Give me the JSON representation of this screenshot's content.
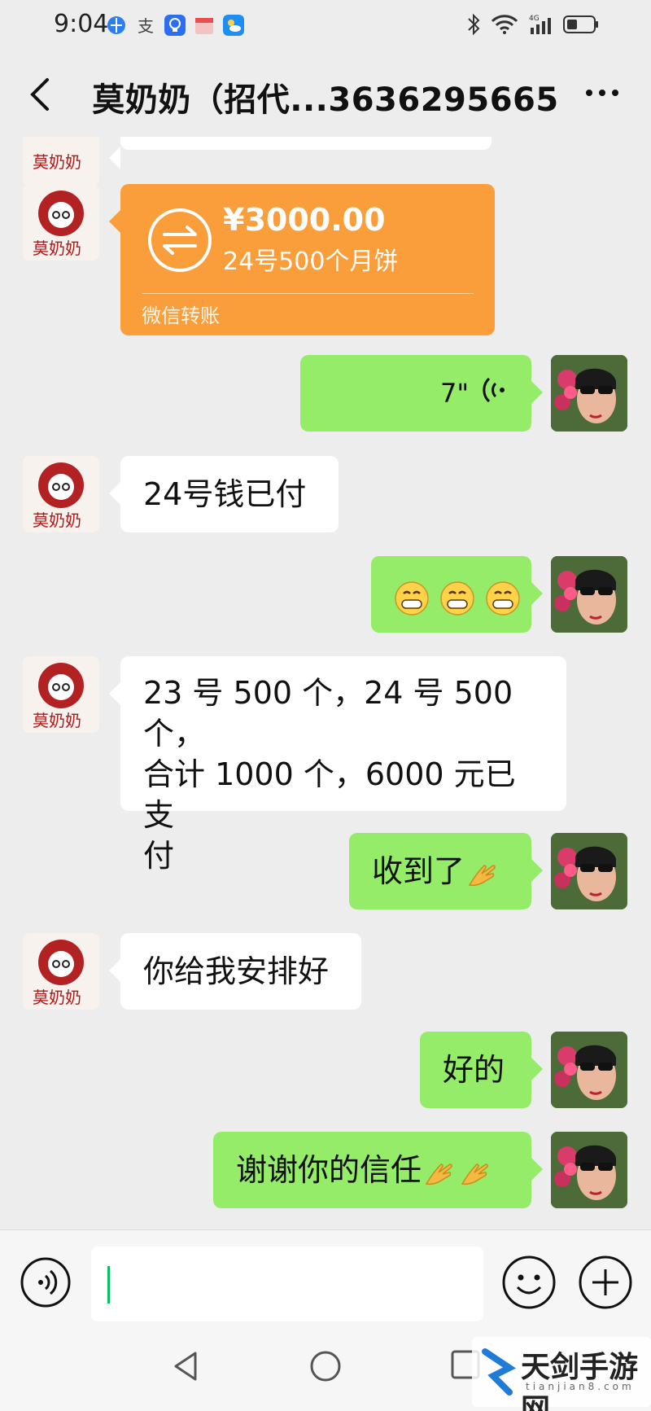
{
  "status_bar": {
    "time": "9:04",
    "network": "4G"
  },
  "header": {
    "title": "莫奶奶（招代...3636295665"
  },
  "contact": {
    "avatar_text": "莫奶奶"
  },
  "messages": {
    "transfer": {
      "amount": "¥3000.00",
      "note": "24号500个月饼",
      "label": "微信转账"
    },
    "voice": {
      "duration": "7\""
    },
    "m1": "24号钱已付",
    "m2_line1": "23 号 500 个，24 号 500 个，",
    "m2_line2": "合计 1000 个，6000 元已支",
    "m2_line3": "付",
    "m3": "收到了",
    "m4": "你给我安排好",
    "m5": "好的",
    "m6": "谢谢你的信任"
  },
  "watermark": {
    "text": "天剑手游网",
    "sub": "tianjian8.com"
  },
  "colors": {
    "sent_bubble": "#95ec69",
    "received_bubble": "#ffffff",
    "transfer": "#fa9e3b",
    "background": "#ededed"
  }
}
